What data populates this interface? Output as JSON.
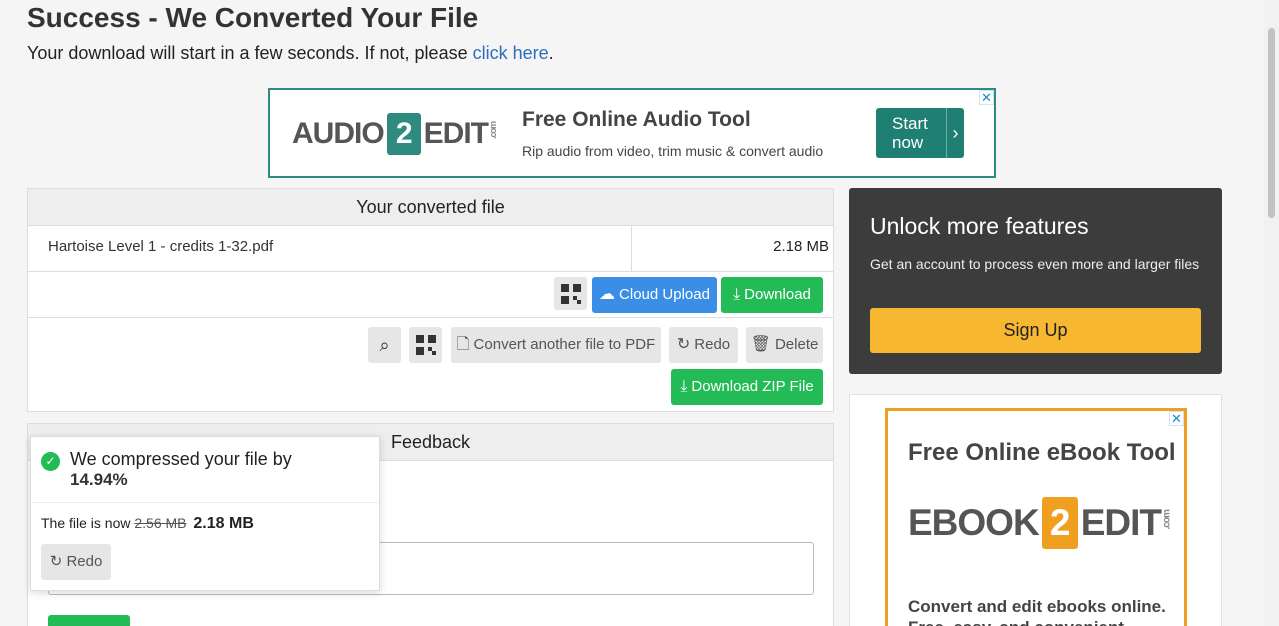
{
  "page": {
    "title": "Success - We Converted Your File",
    "subtitle_prefix": "Your download will start in a few seconds. If not, please",
    "subtitle_link": "click here",
    "subtitle_suffix": "."
  },
  "ad_top": {
    "logo_left": "AUDIO",
    "logo_num": "2",
    "logo_right": "EDIT",
    "logo_com": ".com",
    "headline": "Free Online Audio Tool",
    "subline": "Rip audio from video, trim music & convert audio",
    "cta": "Start now",
    "close": "✕"
  },
  "file_panel": {
    "heading": "Your converted file",
    "file_name": "Hartoise Level 1 - credits 1-32.pdf",
    "file_size": "2.18 MB",
    "cloud_upload": "Cloud Upload",
    "download": "Download",
    "convert_another": "Convert another file to PDF",
    "redo": "Redo",
    "delete": "Delete",
    "download_zip": "Download ZIP File"
  },
  "feedback": {
    "heading": "Feedback"
  },
  "toast": {
    "message": "We compressed your file by",
    "percent": "14.94%",
    "now_prefix": "The file is now",
    "old_size": "2.56 MB",
    "new_size": "2.18 MB",
    "redo": "Redo"
  },
  "unlock": {
    "title": "Unlock more features",
    "description": "Get an account to process even more and larger files",
    "signup": "Sign Up"
  },
  "ad_side": {
    "headline": "Free Online eBook Tool",
    "logo_left": "EBOOK",
    "logo_num": "2",
    "logo_right": "EDIT",
    "logo_com": ".com",
    "description": "Convert and edit ebooks online. Free, easy, and convenient.",
    "close": "✕"
  },
  "colors": {
    "accent_blue": "#3a8ee6",
    "accent_green": "#22bb55",
    "signup_yellow": "#f7b731",
    "dark_panel": "#3c3c3c"
  }
}
